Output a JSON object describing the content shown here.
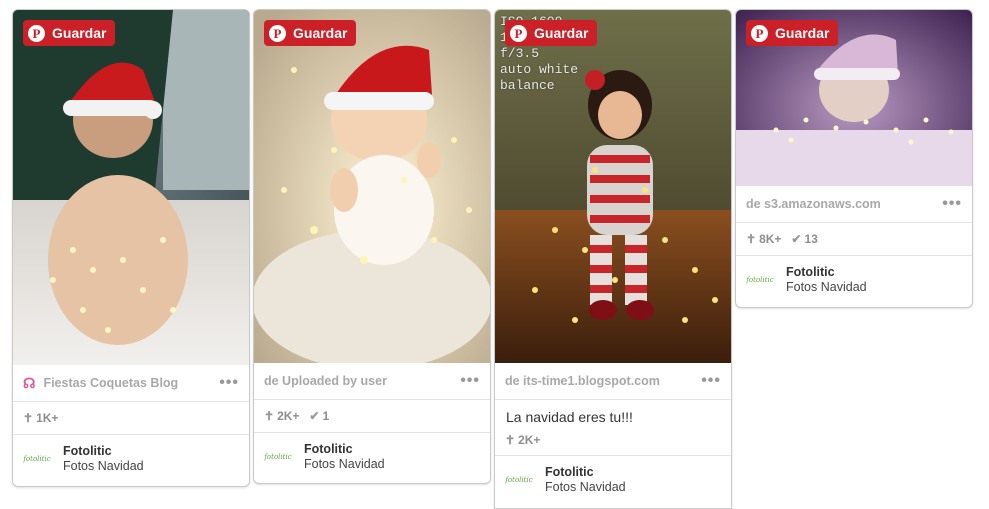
{
  "pins": [
    {
      "save_label": "Guardar",
      "source_text": "Fiestas Coquetas Blog",
      "source_icon": "fiestas-coquetas-logo-icon",
      "description": "",
      "stats": {
        "repins": "1K+",
        "likes": ""
      },
      "owner": "Fotolitic",
      "board": "Fotos Navidad",
      "thumb_text": "fotolitic"
    },
    {
      "save_label": "Guardar",
      "source_text": "de Uploaded by user",
      "description": "",
      "stats": {
        "repins": "2K+",
        "likes": "1"
      },
      "owner": "Fotolitic",
      "board": "Fotos Navidad",
      "thumb_text": "fotolitic"
    },
    {
      "save_label": "Guardar",
      "overlay_text": "ISO 1600\n1/125\nf/3.5\nauto white\nbalance",
      "source_text": "de its-time1.blogspot.com",
      "description": "La navidad eres tu!!!",
      "stats": {
        "repins": "2K+",
        "likes": ""
      },
      "owner": "Fotolitic",
      "board": "Fotos Navidad",
      "thumb_text": "fotolitic"
    },
    {
      "save_label": "Guardar",
      "source_text": "de s3.amazonaws.com",
      "description": "",
      "stats": {
        "repins": "8K+",
        "likes": "13"
      },
      "owner": "Fotolitic",
      "board": "Fotos Navidad",
      "thumb_text": "fotolitic"
    }
  ],
  "colors": {
    "save_button": "#cb2027",
    "source_icon": "#e0579a"
  }
}
